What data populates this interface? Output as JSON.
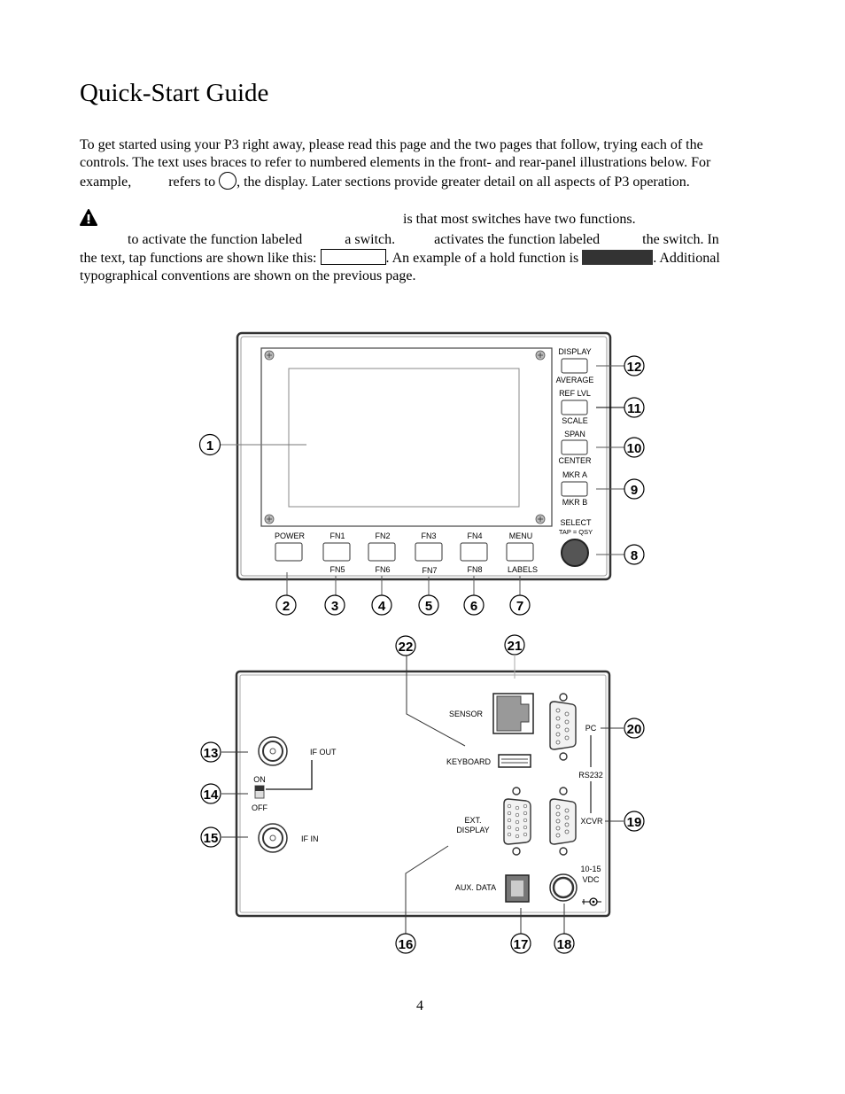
{
  "page": {
    "title": "Quick-Start Guide",
    "page_number": "4"
  },
  "intro": {
    "line1": "To get started using your P3 right away, please read this page and the two pages that follow, trying each of the",
    "line2": "controls. The text uses braces to refer to numbered elements in the front- and rear-panel illustrations below. For",
    "line3_a": "example,",
    "line3_b": "refers to",
    "line3_c": ", the display. Later sections provide greater detail on all aspects of P3 operation."
  },
  "note": {
    "icon": "warning-icon",
    "l1_text": "is that most switches have two functions.",
    "l2_a": "to activate the function labeled",
    "l2_b": "a switch.",
    "l2_c": "activates the function labeled",
    "l2_d": "the switch. In",
    "l3_a": "the text, tap functions are shown like this:",
    "l3_b": ". An example of a hold function is",
    "l3_c": ". Additional",
    "l4": "typographical conventions are shown on the previous page."
  },
  "front_panel": {
    "right_switches": [
      {
        "top": "DISPLAY",
        "bottom": "AVERAGE",
        "callout": "12"
      },
      {
        "top": "REF LVL",
        "bottom": "SCALE",
        "callout": "11"
      },
      {
        "top": "SPAN",
        "bottom": "CENTER",
        "callout": "10"
      },
      {
        "top": "MKR A",
        "bottom": "MKR B",
        "callout": "9"
      }
    ],
    "knob": {
      "top": "SELECT",
      "sub": "TAP = QSY",
      "callout": "8"
    },
    "bottom_switches": [
      {
        "top": "POWER",
        "bottom": "",
        "callout": "2"
      },
      {
        "top": "FN1",
        "bottom": "FN5",
        "callout": "3"
      },
      {
        "top": "FN2",
        "bottom": "FN6",
        "callout": "4"
      },
      {
        "top": "FN3",
        "bottom": "FN7",
        "callout": "5"
      },
      {
        "top": "FN4",
        "bottom": "FN8",
        "callout": "6"
      },
      {
        "top": "MENU",
        "bottom": "LABELS",
        "callout": "7"
      }
    ],
    "display_callout": "1"
  },
  "rear_panel": {
    "labels": {
      "if_out": "IF OUT",
      "on": "ON",
      "off": "OFF",
      "if_in": "IF IN",
      "sensor": "SENSOR",
      "keyboard": "KEYBOARD",
      "ext1": "EXT.",
      "ext2": "DISPLAY",
      "aux": "AUX. DATA",
      "pc": "PC",
      "rs232": "RS232",
      "xcvr": "XCVR",
      "vdc1": "10-15",
      "vdc2": "VDC"
    },
    "callouts": {
      "if_out": "13",
      "switch": "14",
      "if_in": "15",
      "ext_display": "16",
      "aux_data": "17",
      "power_jack": "18",
      "xcvr": "19",
      "pc": "20",
      "sensor": "21",
      "keyboard": "22"
    }
  }
}
